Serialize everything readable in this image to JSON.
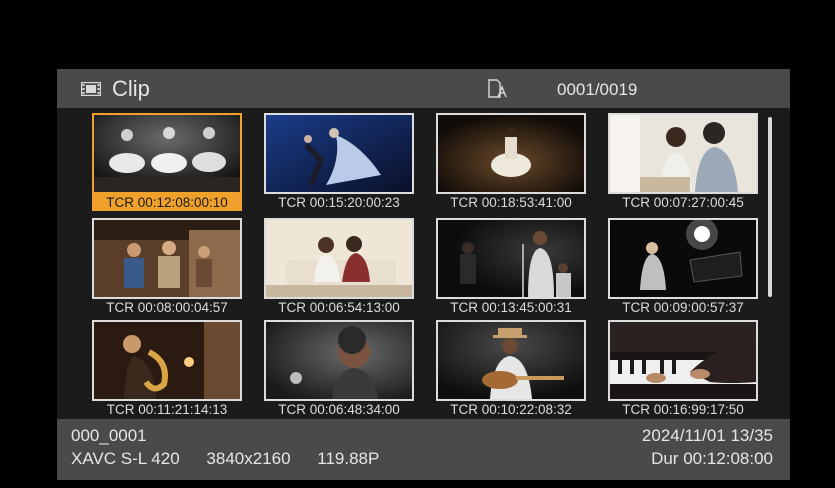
{
  "header": {
    "title": "Clip",
    "counter": "0001/0019",
    "title_icon": "film-strip-icon",
    "media_icon": "media-card-icon"
  },
  "clips": [
    {
      "timecode": "TCR 00:12:08:00:10",
      "selected": true,
      "scene": "dancers on stage"
    },
    {
      "timecode": "TCR 00:15:20:00:23",
      "selected": false,
      "scene": "ballet duo"
    },
    {
      "timecode": "TCR 00:18:53:41:00",
      "selected": false,
      "scene": "dancer in white dress"
    },
    {
      "timecode": "TCR 00:07:27:00:45",
      "selected": false,
      "scene": "couple talking"
    },
    {
      "timecode": "TCR 00:08:00:04:57",
      "selected": false,
      "scene": "kitchen gathering"
    },
    {
      "timecode": "TCR 00:06:54:13:00",
      "selected": false,
      "scene": "friends on sofa"
    },
    {
      "timecode": "TCR 00:13:45:00:31",
      "selected": false,
      "scene": "singer at mic"
    },
    {
      "timecode": "TCR 00:09:00:57:37",
      "selected": false,
      "scene": "pianist under spotlight"
    },
    {
      "timecode": "TCR 00:11:21:14:13",
      "selected": false,
      "scene": "saxophone player"
    },
    {
      "timecode": "TCR 00:06:48:34:00",
      "selected": false,
      "scene": "smiling singer"
    },
    {
      "timecode": "TCR 00:10:22:08:32",
      "selected": false,
      "scene": "guitarist with hat"
    },
    {
      "timecode": "TCR 00:16:99:17:50",
      "selected": false,
      "scene": "hands on piano"
    }
  ],
  "footer": {
    "filename": "000_0001",
    "codec": "XAVC S-L 420",
    "resolution": "3840x2160",
    "framerate": "119.88P",
    "datetime": "2024/11/01 13/35",
    "duration": "Dur 00:12:08:00"
  },
  "colors": {
    "selection": "#f0a12c",
    "bar_background": "#4a4a4a",
    "grid_background": "#1b1b1b"
  }
}
